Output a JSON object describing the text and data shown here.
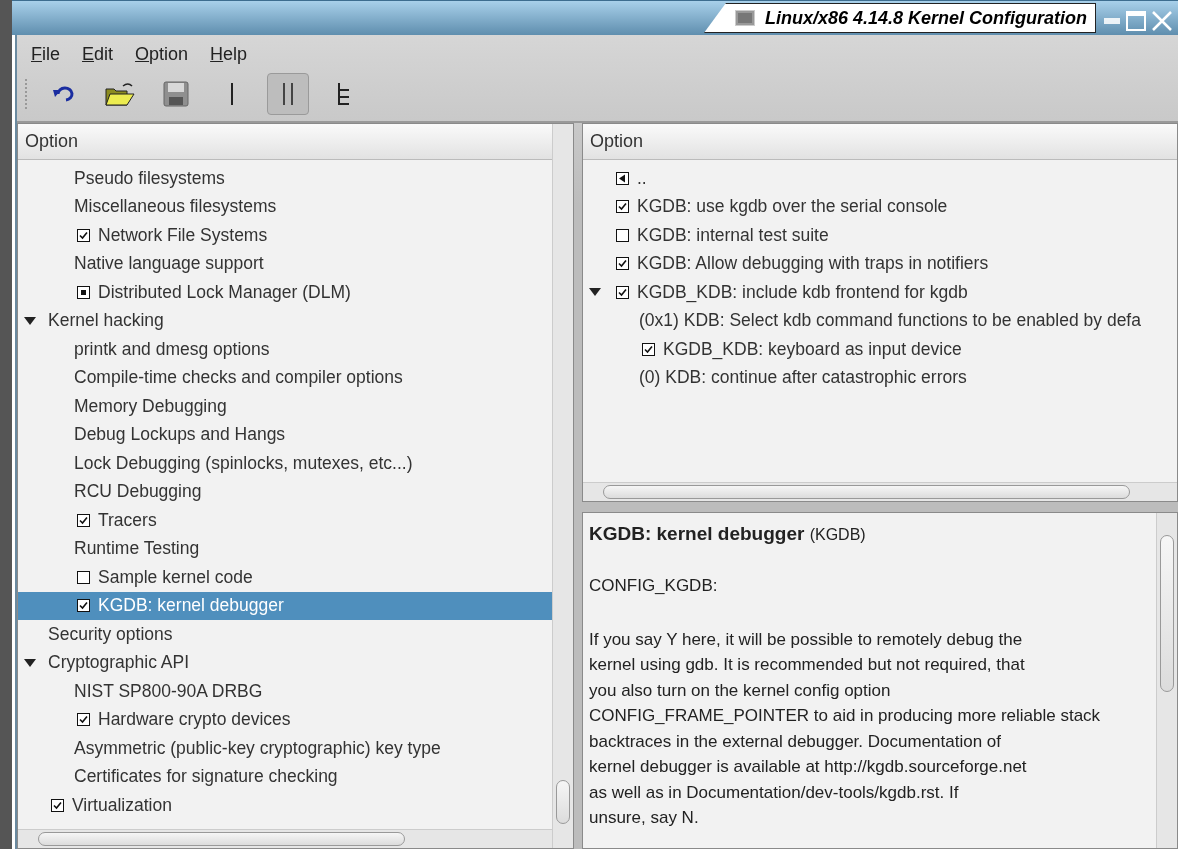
{
  "window": {
    "title": "Linux/x86 4.14.8 Kernel Configuration"
  },
  "menu": [
    "File",
    "Edit",
    "Option",
    "Help"
  ],
  "toolbar": {
    "view_buttons": [
      {
        "kind": "single",
        "selected": false
      },
      {
        "kind": "split",
        "selected": true
      },
      {
        "kind": "full",
        "selected": false
      }
    ]
  },
  "tree": {
    "header": "Option",
    "items": [
      {
        "kind": "continued",
        "children": [
          {
            "kind": "plain",
            "label": "Pseudo filesystems"
          },
          {
            "kind": "plain",
            "label": "Miscellaneous filesystems"
          },
          {
            "kind": "bool",
            "label": "Network File Systems",
            "checked": true
          },
          {
            "kind": "plain",
            "label": "Native language support"
          },
          {
            "kind": "menu",
            "label": "Distributed Lock Manager (DLM)"
          }
        ]
      },
      {
        "kind": "plain",
        "label": "Kernel hacking",
        "expanded": true,
        "children": [
          {
            "kind": "plain",
            "label": "printk and dmesg options"
          },
          {
            "kind": "plain",
            "label": "Compile-time checks and compiler options"
          },
          {
            "kind": "plain",
            "label": "Memory Debugging"
          },
          {
            "kind": "plain",
            "label": "Debug Lockups and Hangs"
          },
          {
            "kind": "plain",
            "label": "Lock Debugging (spinlocks, mutexes, etc...)"
          },
          {
            "kind": "plain",
            "label": "RCU Debugging"
          },
          {
            "kind": "bool",
            "label": "Tracers",
            "checked": true
          },
          {
            "kind": "plain",
            "label": "Runtime Testing"
          },
          {
            "kind": "bool",
            "label": "Sample kernel code",
            "checked": false
          },
          {
            "kind": "bool",
            "label": "KGDB: kernel debugger",
            "checked": true,
            "selected": true
          }
        ]
      },
      {
        "kind": "plain",
        "label": "Security options"
      },
      {
        "kind": "plain",
        "label": "Cryptographic API",
        "expanded": true,
        "children": [
          {
            "kind": "plain",
            "label": "NIST SP800-90A DRBG"
          },
          {
            "kind": "bool",
            "label": "Hardware crypto devices",
            "checked": true
          },
          {
            "kind": "plain",
            "label": "Asymmetric (public-key cryptographic) key type"
          },
          {
            "kind": "plain",
            "label": "Certificates for signature checking"
          }
        ]
      },
      {
        "kind": "bool",
        "label": "Virtualization",
        "checked": true
      }
    ]
  },
  "options": {
    "header": "Option",
    "items": [
      {
        "kind": "parent",
        "label": ".."
      },
      {
        "kind": "bool",
        "label": "KGDB: use kgdb over the serial console",
        "checked": true
      },
      {
        "kind": "bool",
        "label": "KGDB: internal test suite",
        "checked": false
      },
      {
        "kind": "bool",
        "label": "KGDB: Allow debugging with traps in notifiers",
        "checked": true
      },
      {
        "kind": "bool",
        "label": "KGDB_KDB: include kdb frontend for kgdb",
        "checked": true,
        "expanded": true,
        "children": [
          {
            "kind": "plain",
            "label": "(0x1) KDB: Select kdb command functions to be enabled by defa"
          },
          {
            "kind": "bool",
            "label": "KGDB_KDB: keyboard as input device",
            "checked": true
          },
          {
            "kind": "plain",
            "label": "(0) KDB: continue after catastrophic errors"
          }
        ]
      }
    ]
  },
  "help": {
    "title": "KGDB: kernel debugger",
    "symbol": "(KGDB)",
    "config": "CONFIG_KGDB:",
    "text": "If you say Y here, it will be possible to remotely debug the\nkernel using gdb. It is recommended but not required, that\nyou also turn on the kernel config option\nCONFIG_FRAME_POINTER to aid in producing more reliable stack\nbacktraces in the external debugger. Documentation of\nkernel debugger is available at http://kgdb.sourceforge.net\nas well as in Documentation/dev-tools/kgdb.rst. If\nunsure, say N."
  }
}
